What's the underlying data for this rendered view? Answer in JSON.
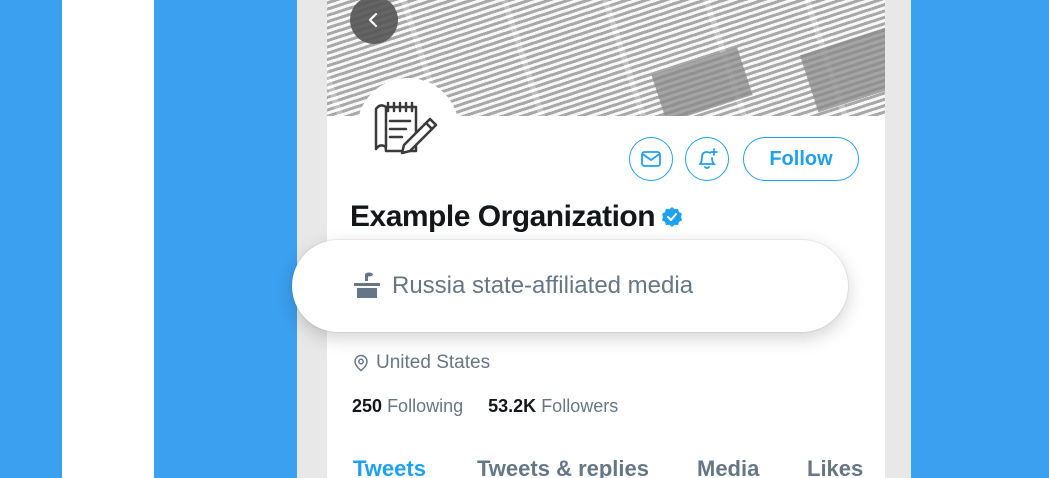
{
  "profile": {
    "name": "Example Organization",
    "follow_label": "Follow",
    "location": "United States",
    "following_count": "250",
    "following_label": "Following",
    "followers_count": "53.2K",
    "followers_label": "Followers"
  },
  "label_pill": {
    "text": "Russia state-affiliated media"
  },
  "tabs": [
    {
      "label": "Tweets",
      "active": true
    },
    {
      "label": "Tweets & replies",
      "active": false
    },
    {
      "label": "Media",
      "active": false
    },
    {
      "label": "Likes",
      "active": false
    }
  ],
  "icons": {
    "back": "chevron-left-icon",
    "message": "envelope-icon",
    "notify": "bell-plus-icon",
    "verified": "verified-badge-icon",
    "location": "map-pin-icon",
    "label": "podium-icon",
    "avatar": "notepad-pen-icon"
  },
  "colors": {
    "accent": "#1da1f2",
    "background": "#3ba0f0",
    "text_primary": "#14171a",
    "text_secondary": "#657786"
  }
}
